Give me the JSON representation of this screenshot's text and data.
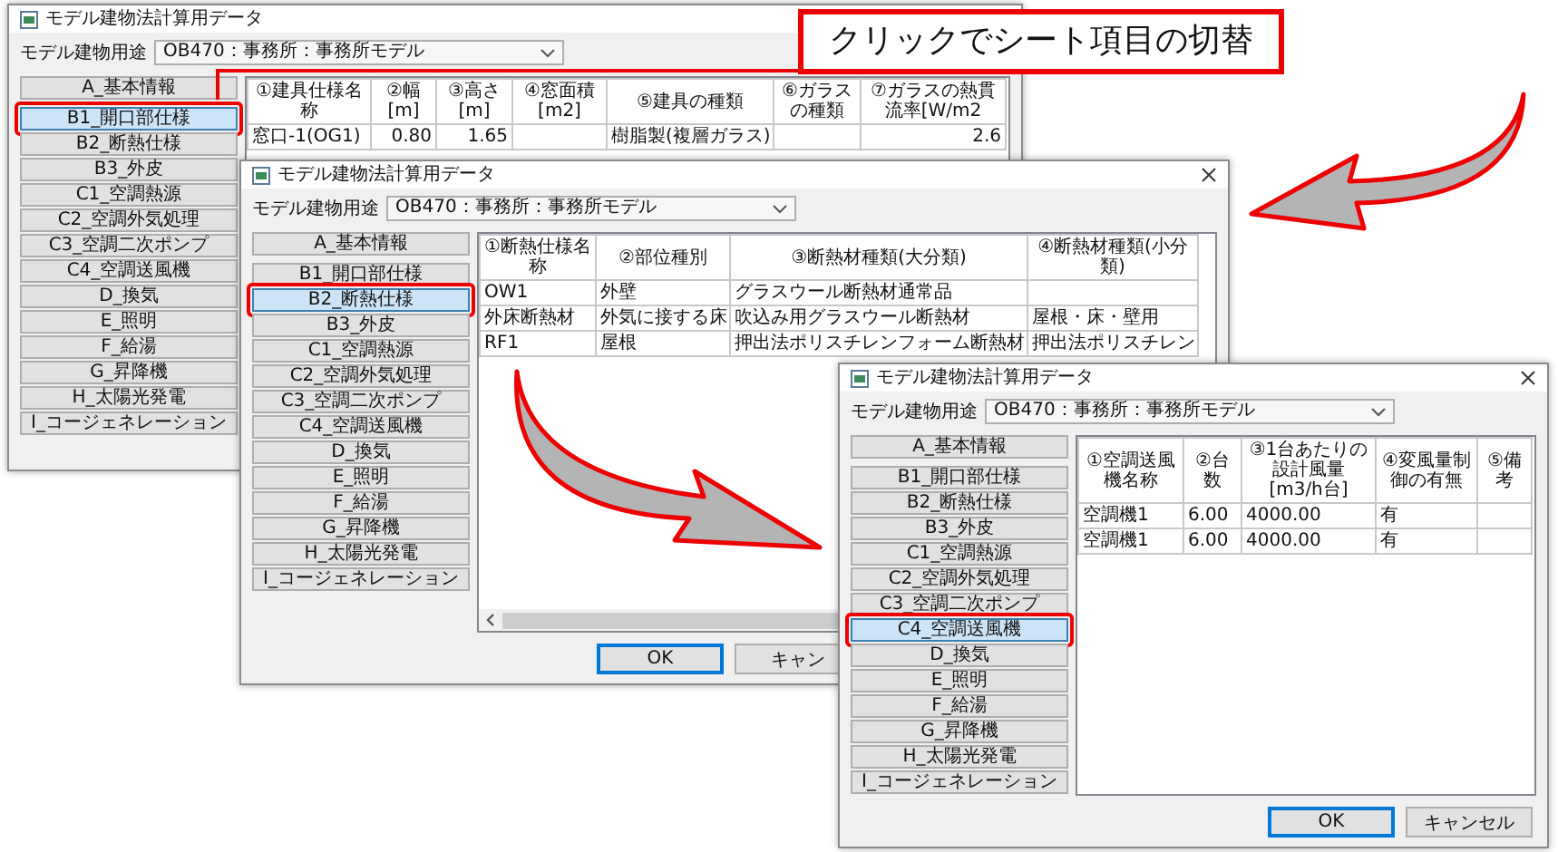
{
  "windows": [
    {
      "title": "モデル建物法計算用データ",
      "usage_label": "モデル建物用途",
      "usage_value": "OB470：事務所：事務所モデル",
      "sidebar": [
        {
          "label": "A_基本情報",
          "selected": false
        },
        {
          "label": "B1_開口部仕様",
          "selected": true
        },
        {
          "label": "B2_断熱仕様",
          "selected": false
        },
        {
          "label": "B3_外皮",
          "selected": false
        },
        {
          "label": "C1_空調熱源",
          "selected": false
        },
        {
          "label": "C2_空調外気処理",
          "selected": false
        },
        {
          "label": "C3_空調二次ポンプ",
          "selected": false
        },
        {
          "label": "C4_空調送風機",
          "selected": false
        },
        {
          "label": "D_換気",
          "selected": false
        },
        {
          "label": "E_照明",
          "selected": false
        },
        {
          "label": "F_給湯",
          "selected": false
        },
        {
          "label": "G_昇降機",
          "selected": false
        },
        {
          "label": "H_太陽光発電",
          "selected": false
        },
        {
          "label": "I_コージェネレーション",
          "selected": false
        }
      ],
      "table": {
        "columns": [
          {
            "label": "①建具仕様名称"
          },
          {
            "label": "②幅[m]",
            "right_aligned": true
          },
          {
            "label": "③高さ[m]",
            "right_aligned": true
          },
          {
            "label": "④窓面積[m2]"
          },
          {
            "label": "⑤建具の種類"
          },
          {
            "label": "⑥ガラスの種類"
          },
          {
            "label": "⑦ガラスの熱貫流率[W/m2",
            "right_aligned": true
          }
        ],
        "rows": [
          [
            "窓口-1(OG1)",
            "0.80",
            "1.65",
            null,
            "樹脂製(複層ガラス)",
            null,
            "2.6"
          ]
        ]
      }
    },
    {
      "title": "モデル建物法計算用データ",
      "close_button": true,
      "usage_label": "モデル建物用途",
      "usage_value": "OB470：事務所：事務所モデル",
      "sidebar": [
        {
          "label": "A_基本情報",
          "selected": false
        },
        {
          "label": "B1_開口部仕様",
          "selected": false
        },
        {
          "label": "B2_断熱仕様",
          "selected": true
        },
        {
          "label": "B3_外皮",
          "selected": false
        },
        {
          "label": "C1_空調熱源",
          "selected": false
        },
        {
          "label": "C2_空調外気処理",
          "selected": false
        },
        {
          "label": "C3_空調二次ポンプ",
          "selected": false
        },
        {
          "label": "C4_空調送風機",
          "selected": false
        },
        {
          "label": "D_換気",
          "selected": false
        },
        {
          "label": "E_照明",
          "selected": false
        },
        {
          "label": "F_給湯",
          "selected": false
        },
        {
          "label": "G_昇降機",
          "selected": false
        },
        {
          "label": "H_太陽光発電",
          "selected": false
        },
        {
          "label": "I_コージェネレーション",
          "selected": false
        }
      ],
      "table": {
        "columns": [
          {
            "label": "①断熱仕様名称"
          },
          {
            "label": "②部位種別"
          },
          {
            "label": "③断熱材種類(大分類)"
          },
          {
            "label": "④断熱材種類(小分類)"
          }
        ],
        "rows": [
          [
            "OW1",
            "外壁",
            "グラスウール断熱材通常品",
            null
          ],
          [
            "外床断熱材",
            "外気に接する床",
            "吹込み用グラスウール断熱材",
            "屋根・床・壁用"
          ],
          [
            "RF1",
            "屋根",
            "押出法ポリスチレンフォーム断熱材",
            "押出法ポリスチレン"
          ]
        ]
      },
      "h_scrollbar": true,
      "buttons": [
        {
          "label": "OK",
          "default": true
        },
        {
          "label": "キャン",
          "default": false
        }
      ]
    },
    {
      "title": "モデル建物法計算用データ",
      "close_button": true,
      "usage_label": "モデル建物用途",
      "usage_value": "OB470：事務所：事務所モデル",
      "sidebar": [
        {
          "label": "A_基本情報",
          "selected": false
        },
        {
          "label": "B1_開口部仕様",
          "selected": false
        },
        {
          "label": "B2_断熱仕様",
          "selected": false
        },
        {
          "label": "B3_外皮",
          "selected": false
        },
        {
          "label": "C1_空調熱源",
          "selected": false
        },
        {
          "label": "C2_空調外気処理",
          "selected": false
        },
        {
          "label": "C3_空調二次ポンプ",
          "selected": false
        },
        {
          "label": "C4_空調送風機",
          "selected": true
        },
        {
          "label": "D_換気",
          "selected": false
        },
        {
          "label": "E_照明",
          "selected": false
        },
        {
          "label": "F_給湯",
          "selected": false
        },
        {
          "label": "G_昇降機",
          "selected": false
        },
        {
          "label": "H_太陽光発電",
          "selected": false
        },
        {
          "label": "I_コージェネレーション",
          "selected": false
        }
      ],
      "table": {
        "columns": [
          {
            "label": "①空調送風機名称"
          },
          {
            "label": "②台数"
          },
          {
            "label": "③1台あたりの設計風量[m3/h台]"
          },
          {
            "label": "④変風量制御の有無"
          },
          {
            "label": "⑤備考"
          }
        ],
        "rows": [
          [
            "空調機1",
            "6.00",
            "4000.00",
            "有",
            null
          ],
          [
            "空調機1",
            "6.00",
            "4000.00",
            "有",
            null
          ]
        ]
      },
      "buttons": [
        {
          "label": "OK",
          "default": true
        },
        {
          "label": "キャンセル",
          "default": false
        }
      ]
    }
  ],
  "callout": {
    "text": "クリックでシート項目の切替"
  }
}
